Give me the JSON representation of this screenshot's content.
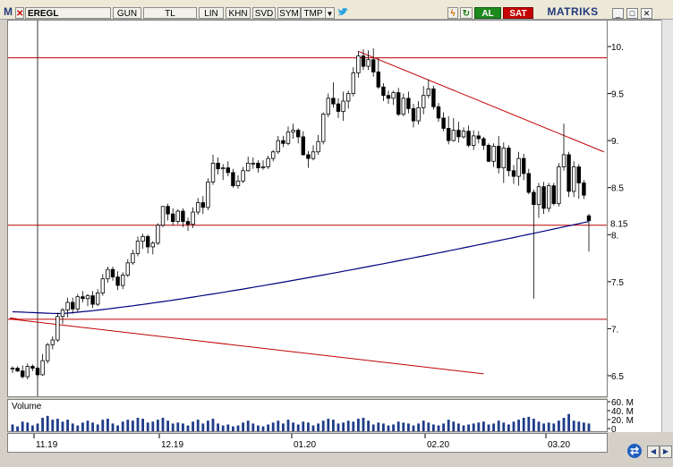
{
  "toolbar": {
    "logo": "M",
    "symbol": "EREGL",
    "buttons": [
      "GUN",
      "TL",
      "LIN",
      "KHN",
      "SVD",
      "SYM",
      "TMP"
    ],
    "buy": "AL",
    "sell": "SAT",
    "brand": "MATRIKS"
  },
  "colors": {
    "up": "#ffffff",
    "down": "#000000",
    "trend": "#c00000",
    "ma": "#000080",
    "volume": "#1f3c88",
    "grid": "#a4b5d8"
  },
  "icons": [
    "dropdown-arrow-icon",
    "twitter-bird-icon",
    "lightning-icon",
    "refresh-icon",
    "minimize-icon",
    "restore-icon",
    "close-icon",
    "sync-icon",
    "left-arrow-icon",
    "right-arrow-icon"
  ],
  "y_ticks": [
    "10.",
    "9.5",
    "9.",
    "8.5",
    "8.",
    "7.5",
    "7.",
    "6.5"
  ],
  "price_label": "8.15",
  "x_ticks": [
    "11.19",
    "12.19",
    "01.20",
    "02.20",
    "03.20"
  ],
  "volume_title": "Volume",
  "volume_ticks": [
    "60. M",
    "40. M",
    "20. M",
    "0"
  ],
  "chart_data": {
    "type": "candlestick",
    "series": [
      {
        "name": "EREGL",
        "ohlc": [
          [
            6.57,
            6.6,
            6.53,
            6.58
          ],
          [
            6.58,
            6.6,
            6.54,
            6.55
          ],
          [
            6.55,
            6.61,
            6.47,
            6.49
          ],
          [
            6.49,
            6.63,
            6.46,
            6.6
          ],
          [
            6.6,
            6.62,
            6.55,
            6.58
          ],
          [
            6.58,
            6.6,
            6.48,
            6.51
          ],
          [
            6.51,
            6.73,
            6.5,
            6.66
          ],
          [
            6.66,
            6.85,
            6.63,
            6.83
          ],
          [
            6.83,
            6.92,
            6.78,
            6.88
          ],
          [
            6.88,
            7.17,
            6.86,
            7.13
          ],
          [
            7.13,
            7.22,
            7.05,
            7.2
          ],
          [
            7.2,
            7.33,
            7.12,
            7.28
          ],
          [
            7.28,
            7.33,
            7.16,
            7.21
          ],
          [
            7.21,
            7.37,
            7.18,
            7.34
          ],
          [
            7.34,
            7.4,
            7.28,
            7.32
          ],
          [
            7.32,
            7.37,
            7.24,
            7.35
          ],
          [
            7.35,
            7.4,
            7.22,
            7.26
          ],
          [
            7.26,
            7.42,
            7.24,
            7.38
          ],
          [
            7.38,
            7.58,
            7.35,
            7.53
          ],
          [
            7.53,
            7.66,
            7.49,
            7.63
          ],
          [
            7.63,
            7.66,
            7.51,
            7.55
          ],
          [
            7.55,
            7.61,
            7.41,
            7.46
          ],
          [
            7.46,
            7.6,
            7.42,
            7.57
          ],
          [
            7.57,
            7.74,
            7.55,
            7.7
          ],
          [
            7.7,
            7.84,
            7.68,
            7.8
          ],
          [
            7.8,
            7.98,
            7.77,
            7.93
          ],
          [
            7.93,
            8.01,
            7.85,
            7.98
          ],
          [
            7.98,
            8.0,
            7.8,
            7.87
          ],
          [
            7.87,
            7.93,
            7.79,
            7.91
          ],
          [
            7.91,
            8.12,
            7.89,
            8.1
          ],
          [
            8.1,
            8.28,
            8.08,
            8.3
          ],
          [
            8.3,
            8.33,
            8.15,
            8.22
          ],
          [
            8.22,
            8.28,
            8.1,
            8.14
          ],
          [
            8.14,
            8.27,
            8.11,
            8.25
          ],
          [
            8.25,
            8.28,
            8.08,
            8.14
          ],
          [
            8.14,
            8.18,
            8.04,
            8.11
          ],
          [
            8.11,
            8.29,
            8.07,
            8.24
          ],
          [
            8.24,
            8.39,
            8.21,
            8.34
          ],
          [
            8.34,
            8.41,
            8.22,
            8.29
          ],
          [
            8.29,
            8.6,
            8.26,
            8.56
          ],
          [
            8.56,
            8.85,
            8.53,
            8.76
          ],
          [
            8.76,
            8.82,
            8.64,
            8.7
          ],
          [
            8.7,
            8.75,
            8.58,
            8.71
          ],
          [
            8.71,
            8.78,
            8.62,
            8.66
          ],
          [
            8.66,
            8.7,
            8.5,
            8.52
          ],
          [
            8.52,
            8.63,
            8.49,
            8.57
          ],
          [
            8.57,
            8.72,
            8.55,
            8.68
          ],
          [
            8.68,
            8.83,
            8.67,
            8.76
          ],
          [
            8.76,
            8.82,
            8.7,
            8.76
          ],
          [
            8.76,
            8.79,
            8.66,
            8.71
          ],
          [
            8.71,
            8.79,
            8.69,
            8.72
          ],
          [
            8.72,
            8.84,
            8.7,
            8.81
          ],
          [
            8.81,
            8.9,
            8.78,
            8.88
          ],
          [
            8.88,
            9.05,
            8.86,
            9.0
          ],
          [
            9.0,
            9.05,
            8.93,
            8.97
          ],
          [
            8.97,
            9.15,
            8.95,
            9.09
          ],
          [
            9.09,
            9.18,
            9.02,
            9.11
          ],
          [
            9.11,
            9.13,
            8.97,
            9.04
          ],
          [
            9.04,
            9.1,
            8.84,
            8.85
          ],
          [
            8.85,
            8.89,
            8.71,
            8.81
          ],
          [
            8.81,
            8.95,
            8.79,
            8.88
          ],
          [
            8.88,
            9.06,
            8.85,
            8.99
          ],
          [
            8.99,
            9.3,
            8.96,
            9.28
          ],
          [
            9.28,
            9.5,
            9.25,
            9.45
          ],
          [
            9.45,
            9.62,
            9.35,
            9.39
          ],
          [
            9.39,
            9.45,
            9.24,
            9.31
          ],
          [
            9.31,
            9.52,
            9.21,
            9.42
          ],
          [
            9.42,
            9.53,
            9.34,
            9.5
          ],
          [
            9.5,
            9.78,
            9.47,
            9.72
          ],
          [
            9.72,
            9.95,
            9.67,
            9.9
          ],
          [
            9.9,
            9.97,
            9.75,
            9.79
          ],
          [
            9.79,
            9.96,
            9.75,
            9.86
          ],
          [
            9.86,
            9.98,
            9.68,
            9.73
          ],
          [
            9.73,
            9.88,
            9.55,
            9.57
          ],
          [
            9.57,
            9.61,
            9.42,
            9.48
          ],
          [
            9.48,
            9.53,
            9.39,
            9.45
          ],
          [
            9.45,
            9.53,
            9.38,
            9.51
          ],
          [
            9.51,
            9.56,
            9.26,
            9.28
          ],
          [
            9.28,
            9.5,
            9.26,
            9.45
          ],
          [
            9.45,
            9.52,
            9.29,
            9.34
          ],
          [
            9.34,
            9.39,
            9.14,
            9.21
          ],
          [
            9.21,
            9.42,
            9.17,
            9.35
          ],
          [
            9.35,
            9.58,
            9.28,
            9.48
          ],
          [
            9.48,
            9.65,
            9.45,
            9.55
          ],
          [
            9.55,
            9.58,
            9.33,
            9.36
          ],
          [
            9.36,
            9.4,
            9.2,
            9.24
          ],
          [
            9.24,
            9.3,
            9.1,
            9.13
          ],
          [
            9.13,
            9.26,
            8.96,
            9.0
          ],
          [
            9.0,
            9.24,
            8.99,
            9.11
          ],
          [
            9.11,
            9.2,
            8.98,
            9.04
          ],
          [
            9.04,
            9.14,
            9.02,
            9.1
          ],
          [
            9.1,
            9.16,
            8.93,
            8.95
          ],
          [
            8.95,
            9.11,
            8.9,
            9.05
          ],
          [
            9.05,
            9.1,
            8.97,
            9.02
          ],
          [
            9.02,
            9.04,
            8.9,
            8.95
          ],
          [
            8.95,
            8.97,
            8.77,
            8.78
          ],
          [
            8.78,
            8.97,
            8.72,
            8.94
          ],
          [
            8.94,
            9.05,
            8.65,
            8.71
          ],
          [
            8.71,
            8.98,
            8.55,
            8.92
          ],
          [
            8.92,
            8.95,
            8.62,
            8.68
          ],
          [
            8.68,
            8.74,
            8.54,
            8.62
          ],
          [
            8.62,
            8.88,
            8.52,
            8.81
          ],
          [
            8.81,
            8.86,
            8.58,
            8.65
          ],
          [
            8.65,
            8.7,
            8.43,
            8.45
          ],
          [
            8.45,
            8.48,
            7.32,
            8.32
          ],
          [
            8.32,
            8.55,
            8.18,
            8.51
          ],
          [
            8.51,
            8.56,
            8.22,
            8.28
          ],
          [
            8.28,
            8.55,
            8.24,
            8.52
          ],
          [
            8.52,
            8.55,
            8.31,
            8.33
          ],
          [
            8.33,
            8.76,
            8.3,
            8.72
          ],
          [
            8.72,
            9.18,
            8.68,
            8.85
          ],
          [
            8.85,
            8.88,
            8.4,
            8.46
          ],
          [
            8.46,
            8.78,
            8.4,
            8.72
          ],
          [
            8.72,
            8.75,
            8.38,
            8.55
          ],
          [
            8.55,
            8.58,
            8.38,
            8.42
          ],
          [
            8.2,
            8.22,
            7.82,
            8.15
          ]
        ]
      }
    ],
    "ylim": [
      6.3,
      10.2
    ],
    "moving_average": {
      "start": 7.18,
      "min": 7.16,
      "end": 8.14
    },
    "horizontal_lines": [
      9.88,
      8.1,
      7.1
    ],
    "trendlines": [
      {
        "from": [
          69,
          9.95
        ],
        "to": [
          118,
          8.88
        ]
      },
      {
        "from": [
          0,
          7.1
        ],
        "to": [
          94,
          6.52
        ]
      }
    ],
    "volume": [
      16,
      12,
      22,
      20,
      14,
      18,
      30,
      34,
      26,
      28,
      22,
      26,
      18,
      14,
      20,
      24,
      20,
      16,
      26,
      28,
      18,
      14,
      22,
      26,
      24,
      30,
      28,
      20,
      22,
      26,
      30,
      24,
      18,
      20,
      18,
      14,
      22,
      26,
      18,
      24,
      28,
      18,
      14,
      16,
      12,
      14,
      20,
      24,
      18,
      14,
      12,
      16,
      20,
      24,
      18,
      26,
      20,
      16,
      22,
      20,
      14,
      18,
      24,
      28,
      26,
      18,
      20,
      24,
      22,
      28,
      30,
      24,
      16,
      20,
      18,
      14,
      16,
      22,
      20,
      18,
      14,
      18,
      24,
      20,
      16,
      14,
      18,
      26,
      22,
      18,
      14,
      16,
      18,
      20,
      22,
      16,
      18,
      24,
      20,
      16,
      22,
      26,
      30,
      32,
      28,
      22,
      18,
      20,
      18,
      24,
      30,
      38,
      24,
      22,
      20,
      18
    ],
    "ylabel": "",
    "xlabel": ""
  }
}
